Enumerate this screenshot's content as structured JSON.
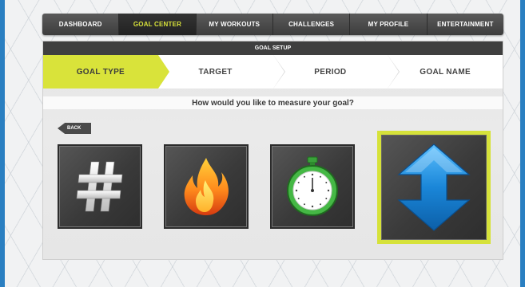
{
  "nav": {
    "tabs": [
      {
        "label": "DASHBOARD"
      },
      {
        "label": "GOAL CENTER"
      },
      {
        "label": "MY WORKOUTS"
      },
      {
        "label": "CHALLENGES"
      },
      {
        "label": "MY PROFILE"
      },
      {
        "label": "ENTERTAINMENT"
      }
    ],
    "active_index": 1
  },
  "setup": {
    "title": "GOAL SETUP",
    "steps": [
      {
        "label": "GOAL TYPE"
      },
      {
        "label": "TARGET"
      },
      {
        "label": "PERIOD"
      },
      {
        "label": "GOAL NAME"
      }
    ],
    "active_step": 0
  },
  "question": "How would you like to measure your goal?",
  "back_label": "BACK",
  "options": [
    {
      "icon": "number-sign-icon"
    },
    {
      "icon": "flame-icon"
    },
    {
      "icon": "stopwatch-icon"
    },
    {
      "icon": "up-down-arrow-icon",
      "selected": true
    }
  ],
  "colors": {
    "accent": "#d9e33a",
    "frame": "#2a7fc1",
    "arrow": "#1a86d8"
  }
}
